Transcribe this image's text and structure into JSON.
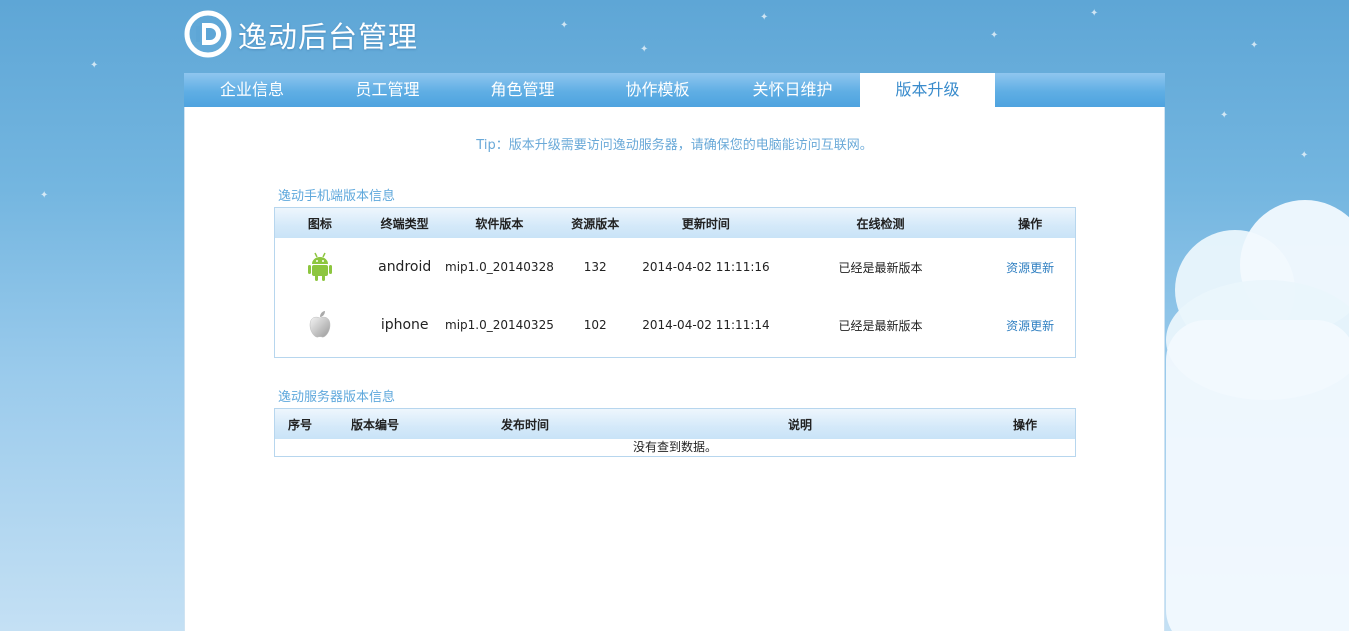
{
  "app": {
    "title": "逸动后台管理",
    "logo_icon": "logo-icon"
  },
  "nav": {
    "items": [
      {
        "label": "企业信息"
      },
      {
        "label": "员工管理"
      },
      {
        "label": "角色管理"
      },
      {
        "label": "协作模板"
      },
      {
        "label": "关怀日维护"
      },
      {
        "label": "版本升级",
        "active": true
      }
    ]
  },
  "tip": "Tip：版本升级需要访问逸动服务器，请确保您的电脑能访问互联网。",
  "mobile": {
    "title": "逸动手机端版本信息",
    "headers": [
      "图标",
      "终端类型",
      "软件版本",
      "资源版本",
      "更新时间",
      "在线检测",
      "操作"
    ],
    "rows": [
      {
        "icon": "android-icon",
        "type": "android",
        "software_version": "mip1.0_20140328",
        "resource_version": "132",
        "updated": "2014-04-02 11:11:16",
        "check": "已经是最新版本",
        "action": "资源更新"
      },
      {
        "icon": "apple-icon",
        "type": "iphone",
        "software_version": "mip1.0_20140325",
        "resource_version": "102",
        "updated": "2014-04-02 11:11:14",
        "check": "已经是最新版本",
        "action": "资源更新"
      }
    ]
  },
  "server": {
    "title": "逸动服务器版本信息",
    "headers": [
      "序号",
      "版本编号",
      "发布时间",
      "说明",
      "操作"
    ],
    "empty": "没有查到数据。"
  },
  "colors": {
    "nav": "#5faee4",
    "accent": "#3a8ccc",
    "link": "#2f7fc1",
    "android": "#8dc63f"
  }
}
